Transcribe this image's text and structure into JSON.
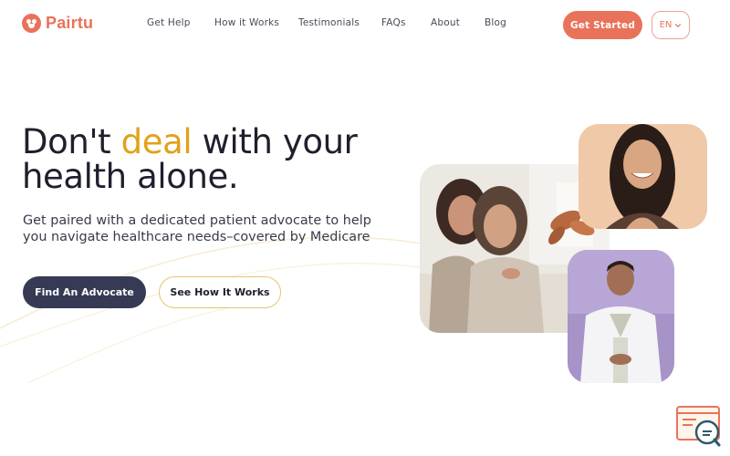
{
  "brand": {
    "name": "Pairtu",
    "color": "#e8735a"
  },
  "nav": {
    "items": [
      {
        "label": "Get Help"
      },
      {
        "label": "How it Works"
      },
      {
        "label": "Testimonials"
      },
      {
        "label": "FAQs"
      },
      {
        "label": "About"
      },
      {
        "label": "Blog"
      }
    ],
    "cta_label": "Get Started",
    "language": "EN"
  },
  "hero": {
    "headline_before": "Don't ",
    "headline_accent": "deal",
    "headline_after": " with your health alone.",
    "subtext": "Get paired with a dedicated patient advocate to help you navigate healthcare needs–covered by Medicare",
    "primary_button": "Find An Advocate",
    "secondary_button": "See How It Works"
  },
  "colors": {
    "accent_orange": "#e8735a",
    "accent_gold": "#e0a21a",
    "navy_button": "#363a55",
    "outline_gold": "#e7c36e"
  },
  "icons": {
    "chevron": "chevron-down-icon",
    "chat": "chat-support-icon",
    "logo": "pairtu-logo-icon"
  }
}
